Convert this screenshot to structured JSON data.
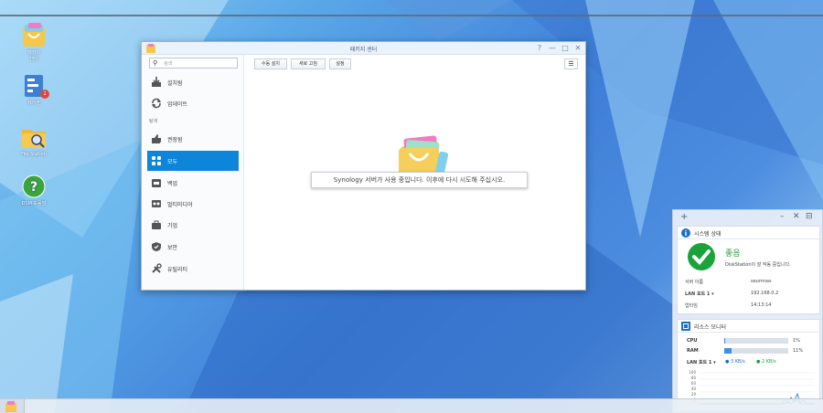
{
  "desktop": {
    "icons": [
      {
        "label": "패키지\n센터",
        "name": "package-center"
      },
      {
        "label": "제어판",
        "name": "control-panel",
        "badge": "1"
      },
      {
        "label": "File Station",
        "name": "file-station"
      },
      {
        "label": "DSM 도움말",
        "name": "dsm-help"
      }
    ]
  },
  "window": {
    "title": "패키지 센터",
    "controls": {
      "help": "?",
      "minimize": "—",
      "maximize": "□",
      "close": "✕"
    },
    "search": {
      "placeholder": "검색",
      "icon": "search-icon"
    },
    "sidebar": {
      "installed": "설치됨",
      "update": "업데이트",
      "section_header": "탐색",
      "recommended": "권장됨",
      "all": "모두",
      "backup": "백업",
      "multimedia": "멀티미디어",
      "business": "기업",
      "security": "보안",
      "utilities": "유틸리티"
    },
    "toolbar": {
      "manual_install": "수동 설치",
      "refresh": "새로 고침",
      "settings": "설정"
    },
    "toast": "Synology 서버가 사용 중입니다. 이후에 다시 시도해 주십시오."
  },
  "widgets": {
    "system_status": {
      "title": "시스템 상태",
      "status": "좋음",
      "message": "DiskStation이 잘 작동 중입니다.",
      "rows": [
        {
          "key": "서버 이름",
          "value": "seumnas"
        },
        {
          "key": "LAN 포트 1 ▾",
          "value": "192.168.0.2"
        },
        {
          "key": "업타임",
          "value": "14:13:14"
        }
      ]
    },
    "resource_monitor": {
      "title": "리소스 모니터",
      "cpu_label": "CPU",
      "cpu_pct": "1%",
      "cpu_value": 1,
      "ram_label": "RAM",
      "ram_pct": "11%",
      "ram_value": 11,
      "lan_label": "LAN 포트 1 ▾",
      "lan_up": "3 KB/s",
      "lan_down": "2 KB/s",
      "y_ticks": [
        "100",
        "80",
        "60",
        "40",
        "20",
        "0"
      ]
    }
  },
  "colors": {
    "accent": "#0d86d9",
    "ok_green": "#1aa33a",
    "status_text_green": "#2a9d3a"
  }
}
